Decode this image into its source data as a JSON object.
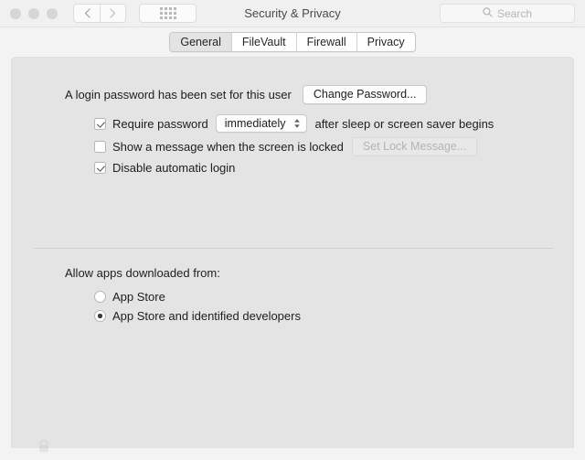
{
  "window": {
    "title": "Security & Privacy",
    "traffic_lights": [
      "close",
      "minimize",
      "zoom"
    ]
  },
  "toolbar": {
    "back_icon": "chevron-left-icon",
    "forward_icon": "chevron-right-icon",
    "show_all_icon": "grid-icon",
    "search": {
      "placeholder": "Search",
      "icon": "search-icon",
      "value": ""
    }
  },
  "tabs": [
    {
      "label": "General",
      "selected": true
    },
    {
      "label": "FileVault",
      "selected": false
    },
    {
      "label": "Firewall",
      "selected": false
    },
    {
      "label": "Privacy",
      "selected": false
    }
  ],
  "general": {
    "password_status": "A login password has been set for this user",
    "change_password_button": "Change Password...",
    "require_password": {
      "label": "Require password",
      "checked": true,
      "delay_value": "immediately",
      "suffix": "after sleep or screen saver begins",
      "stepper_icon": "chevron-up-down-icon"
    },
    "lock_message": {
      "label": "Show a message when the screen is locked",
      "checked": false,
      "button": "Set Lock Message...",
      "button_disabled": true
    },
    "disable_auto_login": {
      "label": "Disable automatic login",
      "checked": true
    },
    "allow_apps": {
      "heading": "Allow apps downloaded from:",
      "options": [
        {
          "label": "App Store",
          "selected": false
        },
        {
          "label": "App Store and identified developers",
          "selected": true
        }
      ]
    }
  },
  "footer": {
    "lock_icon": "lock-icon"
  },
  "colors": {
    "window_bg": "#f3f3f3",
    "panel_bg": "#e4e4e4",
    "toolbar_bg": "#f0f0f0",
    "text": "#1d1d1d",
    "disabled_text": "#b3b3b3"
  }
}
